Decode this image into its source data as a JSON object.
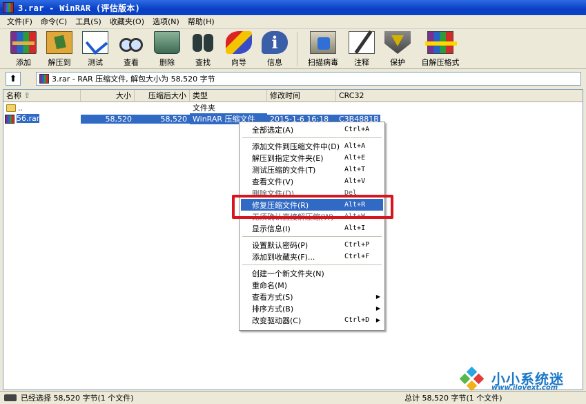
{
  "window": {
    "title": "3.rar - WinRAR (评估版本)"
  },
  "menubar": [
    "文件(F)",
    "命令(C)",
    "工具(S)",
    "收藏夹(O)",
    "选项(N)",
    "帮助(H)"
  ],
  "toolbar": {
    "buttons": [
      {
        "label": "添加",
        "icon": "add-archive-icon"
      },
      {
        "label": "解压到",
        "icon": "extract-to-icon"
      },
      {
        "label": "测试",
        "icon": "test-icon"
      },
      {
        "label": "查看",
        "icon": "view-icon"
      },
      {
        "label": "删除",
        "icon": "delete-icon"
      },
      {
        "label": "查找",
        "icon": "find-icon"
      },
      {
        "label": "向导",
        "icon": "wizard-icon"
      },
      {
        "label": "信息",
        "icon": "info-icon"
      },
      {
        "label": "扫描病毒",
        "icon": "virus-scan-icon"
      },
      {
        "label": "注释",
        "icon": "comment-icon"
      },
      {
        "label": "保护",
        "icon": "protect-icon"
      },
      {
        "label": "自解压格式",
        "icon": "sfx-icon"
      }
    ]
  },
  "address": {
    "text": "3.rar - RAR 压缩文件, 解包大小为 58,520 字节"
  },
  "columns": [
    "名称",
    "大小",
    "压缩后大小",
    "类型",
    "修改时间",
    "CRC32"
  ],
  "rows": [
    {
      "name": "..",
      "size": "",
      "packed": "",
      "type": "文件夹",
      "time": "",
      "crc": ""
    },
    {
      "name": "56.rar",
      "size": "58,520",
      "packed": "58,520",
      "type": "WinRAR 压缩文件",
      "time": "2015-1-6 16:18",
      "crc": "C3B4881B"
    }
  ],
  "context_menu": {
    "groups": [
      [
        {
          "label": "全部选定(A)",
          "key": "Ctrl+A"
        }
      ],
      [
        {
          "label": "添加文件到压缩文件中(D)",
          "key": "Alt+A"
        },
        {
          "label": "解压到指定文件夹(E)",
          "key": "Alt+E"
        },
        {
          "label": "测试压缩的文件(T)",
          "key": "Alt+T"
        },
        {
          "label": "查看文件(V)",
          "key": "Alt+V"
        },
        {
          "label": "删除文件(D)",
          "key": "Del"
        },
        {
          "label": "修复压缩文件(R)",
          "key": "Alt+R"
        },
        {
          "label": "无须确认直接解压缩(W)",
          "key": "Alt+W"
        },
        {
          "label": "显示信息(I)",
          "key": "Alt+I"
        }
      ],
      [
        {
          "label": "设置默认密码(P)",
          "key": "Ctrl+P"
        },
        {
          "label": "添加到收藏夹(F)...",
          "key": "Ctrl+F"
        }
      ],
      [
        {
          "label": "创建一个新文件夹(N)",
          "key": ""
        },
        {
          "label": "重命名(M)",
          "key": ""
        },
        {
          "label": "查看方式(S)",
          "key": ""
        },
        {
          "label": "排序方式(B)",
          "key": ""
        },
        {
          "label": "改变驱动器(C)",
          "key": "Ctrl+D"
        }
      ]
    ],
    "highlighted": "修复压缩文件(R)"
  },
  "status": {
    "left": "已经选择 58,520 字节(1 个文件)",
    "right": "总计 58,520 字节(1 个文件)"
  },
  "watermark": {
    "name": "小小系统迷",
    "url": "www.ilovext.com"
  },
  "colors": {
    "selection": "#316ac5",
    "highlight_box": "#d8141f",
    "titlebar": "#0a3fc4"
  }
}
